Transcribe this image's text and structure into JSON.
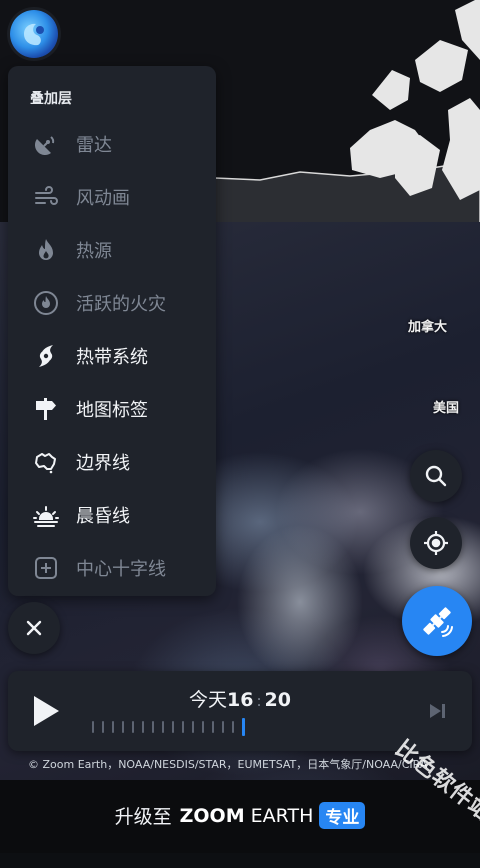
{
  "panel": {
    "title": "叠加层",
    "items": [
      {
        "label": "雷达",
        "icon": "radar-icon",
        "state": "muted"
      },
      {
        "label": "风动画",
        "icon": "wind-icon",
        "state": "muted"
      },
      {
        "label": "热源",
        "icon": "fire-icon",
        "state": "muted"
      },
      {
        "label": "活跃的火灾",
        "icon": "active-fire-icon",
        "state": "muted"
      },
      {
        "label": "热带系统",
        "icon": "hurricane-icon",
        "state": "active"
      },
      {
        "label": "地图标签",
        "icon": "signpost-icon",
        "state": "active"
      },
      {
        "label": "边界线",
        "icon": "boundary-icon",
        "state": "active"
      },
      {
        "label": "晨昏线",
        "icon": "sunrise-icon",
        "state": "active"
      },
      {
        "label": "中心十字线",
        "icon": "crosshair-box-icon",
        "state": "muted"
      }
    ]
  },
  "map": {
    "labels": {
      "canada": "加拿大",
      "usa": "美国"
    }
  },
  "timeline": {
    "day": "今天",
    "hour": "16",
    "minute": "20",
    "ticks_total": 16,
    "current_tick": 16
  },
  "credits": "© Zoom Earth，NOAA/NESDIS/STAR，EUMETSAT，日本气象厅/NOAA/CIRA",
  "banner": {
    "prefix": "升级至",
    "brand_bold": "ZOOM",
    "brand_rest": "EARTH",
    "badge": "专业"
  },
  "watermark": "比色软件站",
  "colors": {
    "panel_bg": "#1f232b",
    "accent": "#2786f3",
    "muted_text": "#7f8794",
    "active_text": "#f1f3f6"
  }
}
